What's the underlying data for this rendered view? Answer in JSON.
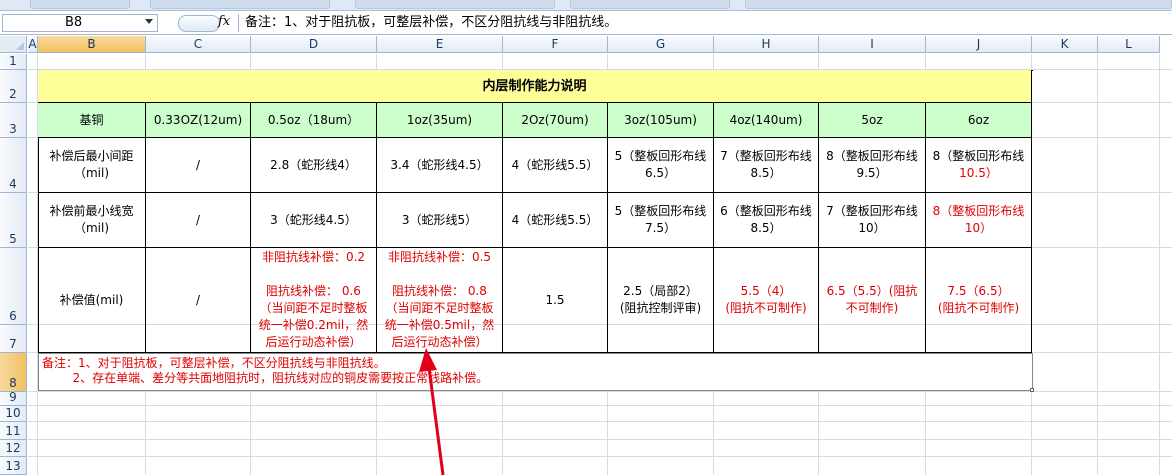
{
  "formula_bar": {
    "name_box": "B8",
    "fx": "fx",
    "formula": "备注：1、对于阻抗板，可整层补偿，不区分阻抗线与非阻抗线。"
  },
  "columns": [
    "A",
    "B",
    "C",
    "D",
    "E",
    "F",
    "G",
    "H",
    "I",
    "J",
    "K",
    "L"
  ],
  "rows": [
    "1",
    "2",
    "3",
    "4",
    "5",
    "6",
    "7",
    "8",
    "9",
    "10",
    "11",
    "12",
    "13"
  ],
  "table": {
    "title": "内层制作能力说明",
    "headers": [
      "基铜",
      "0.33OZ(12um)",
      "0.5oz（18um）",
      "1oz(35um)",
      "2Oz(70um)",
      "3oz(105um)",
      "4oz(140um)",
      "5oz",
      "6oz"
    ],
    "row_min_spacing": {
      "label": [
        "补偿后最小间距",
        "（mil)"
      ],
      "values": [
        [
          "/"
        ],
        [
          "2.8（蛇形线4）"
        ],
        [
          "3.4（蛇形线4.5）"
        ],
        [
          "4（蛇形线5.5）"
        ],
        [
          "5（整板回形布线",
          "6.5）"
        ],
        [
          "7（整板回形布线",
          "8.5）"
        ],
        [
          "8（整板回形布线",
          "9.5）"
        ]
      ],
      "last": {
        "black": "8（整板回形布线",
        "red": "10.5）"
      }
    },
    "row_min_width": {
      "label": [
        "补偿前最小线宽",
        "（mil)"
      ],
      "values": [
        [
          "/"
        ],
        [
          "3（蛇形线4.5）"
        ],
        [
          "3（蛇形线5）"
        ],
        [
          "4（蛇形线5.5）"
        ],
        [
          "5（整板回形布线",
          "7.5）"
        ],
        [
          "6（整板回形布线",
          "8.5）"
        ],
        [
          "7（整板回形布线",
          "10）"
        ]
      ],
      "last": [
        "8（整板回形布线",
        "10）"
      ]
    },
    "row_comp": {
      "label": "补偿值(mil)",
      "c": "/",
      "d": [
        "非阻抗线补偿：0.2",
        "",
        "阻抗线补偿： 0.6",
        "（当间距不足时整板",
        "统一补偿0.2mil，然",
        "后运行动态补偿）"
      ],
      "e": [
        "非阻抗线补偿：0.5",
        "",
        "阻抗线补偿： 0.8",
        "（当间距不足时整板",
        "统一补偿0.5mil，然",
        "后运行动态补偿）"
      ],
      "f": "1.5",
      "g": [
        "2.5（局部2）",
        "(阻抗控制评审)"
      ],
      "h": [
        "5.5（4）",
        "(阻抗不可制作)"
      ],
      "i": [
        "6.5（5.5）(阻抗",
        "不可制作)"
      ],
      "j": [
        "7.5（6.5）",
        "(阻抗不可制作)"
      ]
    },
    "note": [
      "备注：1、对于阻抗板，可整层补偿，不区分阻抗线与非阻抗线。",
      "        2、存在单端、差分等共面地阻抗时，阻抗线对应的铜皮需要按正常线路补偿。"
    ]
  },
  "colors": {
    "title_fill": "#ffff99",
    "header_fill": "#ccffcc",
    "red_text": "#e00000",
    "arrow": "#e0001a"
  }
}
